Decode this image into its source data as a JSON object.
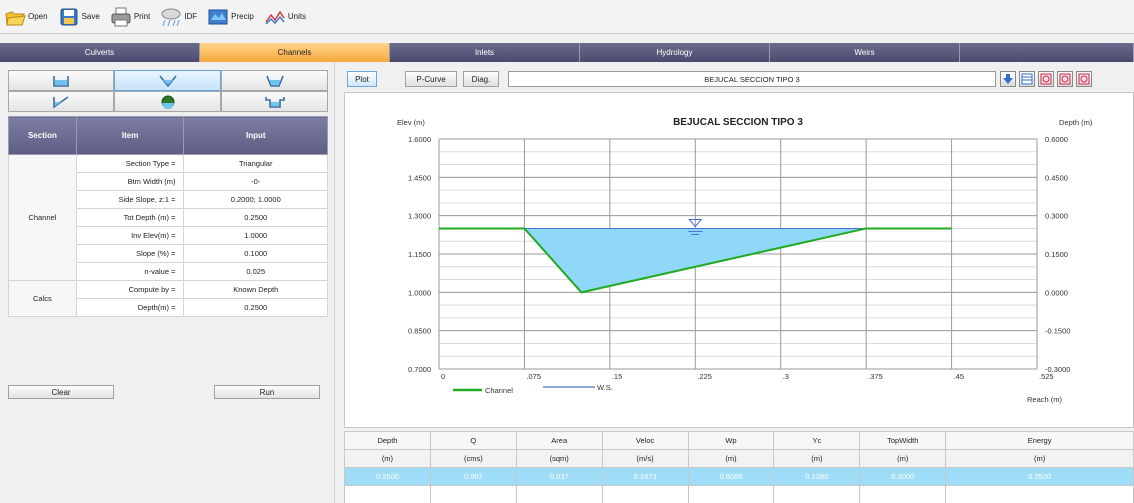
{
  "toolbar": {
    "open": "Open",
    "save": "Save",
    "print": "Print",
    "idf": "IDF",
    "precip": "Precip",
    "units": "Units"
  },
  "main_tabs": [
    "Culverts",
    "Channels",
    "Inlets",
    "Hydrology",
    "Weirs",
    ""
  ],
  "active_main_tab": "Channels",
  "left": {
    "headers": {
      "section": "Section",
      "item": "Item",
      "input": "Input"
    },
    "rows": [
      {
        "item": "Section Type =",
        "value": "Triangular"
      },
      {
        "item": "Btm Width (m)",
        "value": "-0-"
      },
      {
        "item": "Side Slope, z:1 =",
        "value": "0.2000; 1.0000"
      },
      {
        "item": "Tot Depth (m) =",
        "value": "0.2500"
      },
      {
        "item": "Inv Elev(m) =",
        "value": "1.0000"
      },
      {
        "item": "Slope (%) =",
        "value": "0.1000"
      },
      {
        "item": "n-value =",
        "value": "0.025"
      },
      {
        "item": "Compute by =",
        "value": "Known Depth"
      },
      {
        "item": "Depth(m) =",
        "value": "0.2500"
      }
    ],
    "section_channel": "Channel",
    "section_calcs": "Calcs",
    "clear_button": "Clear",
    "run_button": "Run"
  },
  "right": {
    "tabs": {
      "plot": "Plot",
      "pcurve": "P-Curve",
      "diag": "Diag."
    },
    "title_value": "BEJUCAL SECCION TIPO 3",
    "results_headers": [
      "Depth",
      "Q",
      "Area",
      "Veloc",
      "Wp",
      "Yc",
      "TopWidth",
      "Energy"
    ],
    "results_units": [
      "(m)",
      "(cms)",
      "(sqm)",
      "(m/s)",
      "(m)",
      "(m)",
      "(m)",
      "(m)"
    ],
    "results_values": [
      "0.2500",
      "0.007",
      "0.037",
      "0.1973",
      "0.6085",
      "0.1280",
      "0.3000",
      "0.2520"
    ]
  },
  "chart_data": {
    "type": "line",
    "title": "BEJUCAL SECCION TIPO 3",
    "ylabel_left": "Elev (m)",
    "ylabel_right": "Depth (m)",
    "xlabel": "Reach (m)",
    "xlim": [
      0,
      0.525
    ],
    "ylim": [
      0.7,
      1.6
    ],
    "x_ticks": [
      "0",
      ".075",
      ".15",
      ".225",
      ".3",
      ".375",
      ".45",
      ".525"
    ],
    "y_ticks_left": [
      "1.6000",
      "1.4500",
      "1.3000",
      "1.1500",
      "1.0000",
      "0.8500",
      "0.7000"
    ],
    "y_ticks_right": [
      "0.6000",
      "0.4500",
      "0.3000",
      "0.1500",
      "0.0000",
      "-0.1500",
      "-0.3000"
    ],
    "series": [
      {
        "name": "Channel",
        "color": "#22aa22",
        "x": [
          0,
          0.075,
          0.125,
          0.375,
          0.45
        ],
        "y": [
          1.25,
          1.25,
          1.0,
          1.25,
          1.25
        ]
      },
      {
        "name": "W.S.",
        "color": "#4a6fd0",
        "x": [
          0.075,
          0.375
        ],
        "y": [
          1.25,
          1.25
        ]
      }
    ],
    "fill_color": "#8fd8f7",
    "grid": true,
    "legend": "bottom-left"
  }
}
